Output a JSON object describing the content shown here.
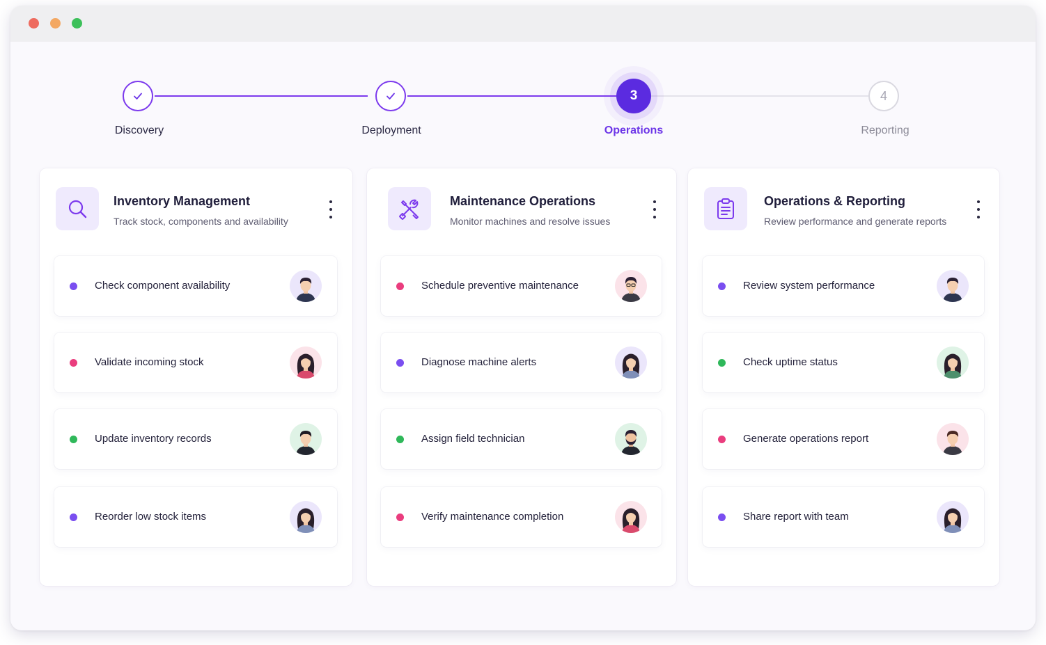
{
  "window": {
    "controls": [
      {
        "name": "close",
        "color": "#ee6b5f"
      },
      {
        "name": "minimize",
        "color": "#f3a863"
      },
      {
        "name": "maximize",
        "color": "#3cc05a"
      }
    ]
  },
  "stepper": {
    "steps": [
      {
        "label": "Discovery",
        "state": "done",
        "number": ""
      },
      {
        "label": "Deployment",
        "state": "done",
        "number": ""
      },
      {
        "label": "Operations",
        "state": "active",
        "number": "3"
      },
      {
        "label": "Reporting",
        "state": "pending",
        "number": "4"
      }
    ]
  },
  "colors": {
    "accent": "#6d36e8",
    "accent_dark": "#5b2be0",
    "status_purple": "#7a4ef0",
    "status_pink": "#ea3d7e",
    "status_green": "#2fb85a"
  },
  "panels": [
    {
      "title": "Inventory Management",
      "subtitle": "Track stock, components and availability",
      "icon": "search-icon",
      "tasks": [
        {
          "label": "Check component availability",
          "status": "purple",
          "avatar": "man-short-hair"
        },
        {
          "label": "Validate incoming stock",
          "status": "pink",
          "avatar": "woman-long-hair"
        },
        {
          "label": "Update inventory records",
          "status": "green",
          "avatar": "man-short-hair"
        },
        {
          "label": "Reorder low stock items",
          "status": "purple",
          "avatar": "woman-long-hair"
        }
      ]
    },
    {
      "title": "Maintenance Operations",
      "subtitle": "Monitor machines and resolve issues",
      "icon": "tools-icon",
      "tasks": [
        {
          "label": "Schedule preventive maintenance",
          "status": "pink",
          "avatar": "man-glasses"
        },
        {
          "label": "Diagnose machine alerts",
          "status": "purple",
          "avatar": "woman-long-hair"
        },
        {
          "label": "Assign field technician",
          "status": "green",
          "avatar": "man-beard"
        },
        {
          "label": "Verify maintenance completion",
          "status": "pink",
          "avatar": "woman-long-hair"
        }
      ]
    },
    {
      "title": "Operations & Reporting",
      "subtitle": "Review performance and generate reports",
      "icon": "clipboard-icon",
      "tasks": [
        {
          "label": "Review system performance",
          "status": "purple",
          "avatar": "man-short-hair"
        },
        {
          "label": "Check uptime status",
          "status": "green",
          "avatar": "woman-long-hair"
        },
        {
          "label": "Generate operations report",
          "status": "pink",
          "avatar": "man-short-hair"
        },
        {
          "label": "Share report with team",
          "status": "purple",
          "avatar": "woman-long-hair"
        }
      ]
    }
  ]
}
